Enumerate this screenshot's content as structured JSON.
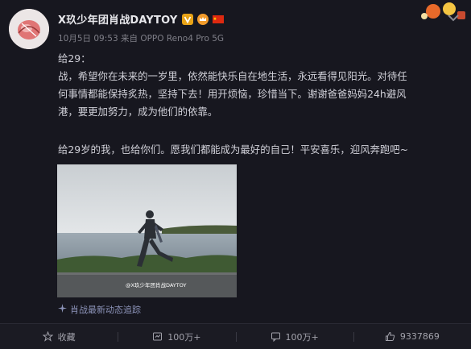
{
  "post": {
    "author": "X玖少年团肖战DAYTOY",
    "meta": "10月5日 09:53 来自 OPPO Reno4 Pro 5G",
    "lines": [
      "给29：",
      "战，希望你在未来的一岁里，依然能快乐自在地生活，永远看得见阳光。对待任",
      "何事情都能保持炙热，坚持下去！用开烦恼，珍惜当下。谢谢爸爸妈妈24h避风",
      "港，要更加努力，成为他们的依靠。"
    ],
    "closing": "给29岁的我，也给你们。愿我们都能成为最好的自己！平安喜乐，迎风奔跑吧~",
    "watermark": "@X玖少年团肖战DAYTOY",
    "topic": "肖战最新动态追踪",
    "colors": {
      "accent": "#e8a317",
      "link": "#8c93b8"
    }
  },
  "actions": {
    "favorite": "收藏",
    "repost": "100万+",
    "comment": "100万+",
    "like": "9337869"
  }
}
